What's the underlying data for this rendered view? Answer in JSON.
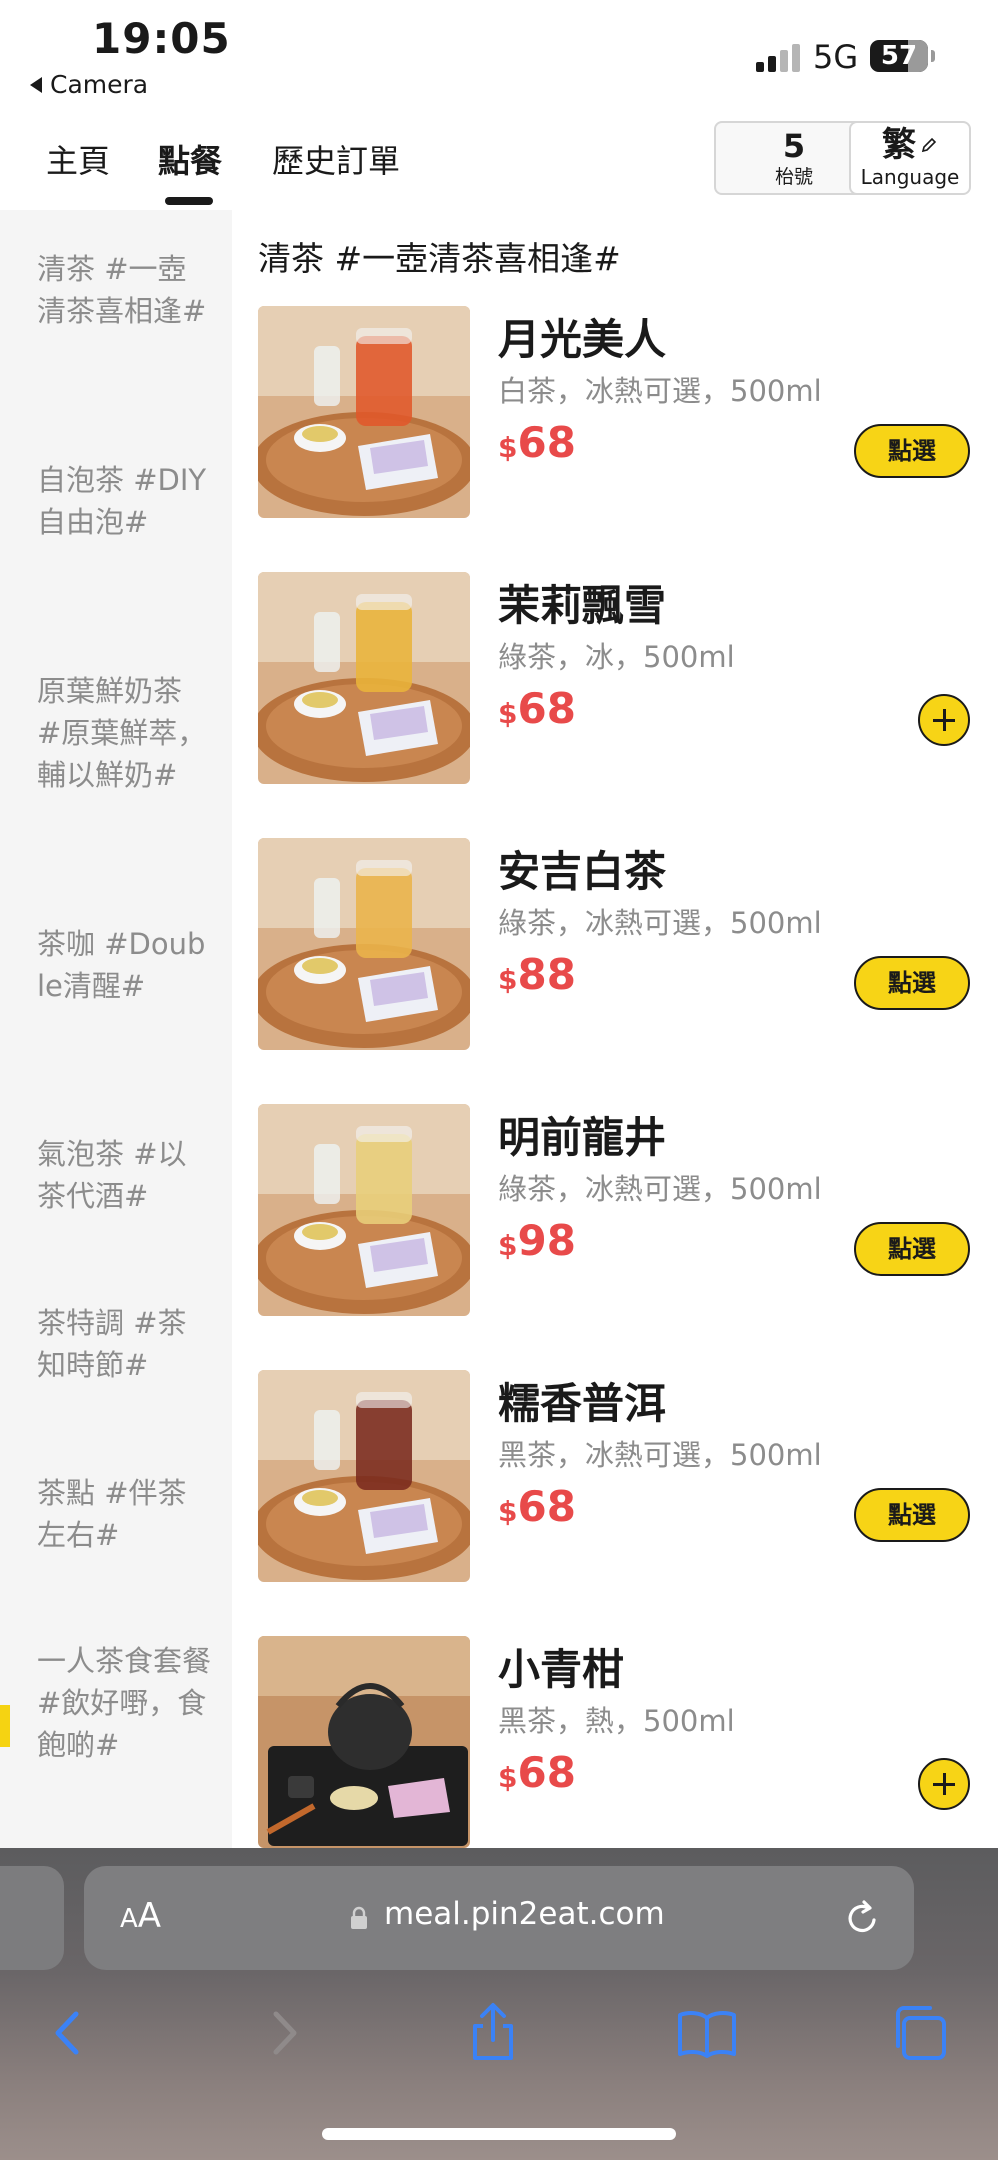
{
  "status_bar": {
    "time": "19:05",
    "back_app": "Camera",
    "network": "5G",
    "battery": "57"
  },
  "nav": {
    "tabs": [
      {
        "label": "主頁",
        "active": false
      },
      {
        "label": "點餐",
        "active": true
      },
      {
        "label": "歷史訂單",
        "active": false
      }
    ],
    "table_number": "5",
    "table_label": "枱號",
    "language_char": "繁",
    "language_label": "Language"
  },
  "sidebar": {
    "categories": [
      "清茶 #一壺清茶喜相逢#",
      "自泡茶 #DIY自由泡#",
      "原葉鮮奶茶 #原葉鮮萃，輔以鮮奶#",
      "茶咖 #Double清醒#",
      "氣泡茶 #以茶代酒#",
      "茶特調 #茶知時節#",
      "茶點 #伴茶左右#",
      "一人茶食套餐 #飲好嘢，食飽啲#"
    ]
  },
  "menu": {
    "section_title": "清茶 #一壺清茶喜相逢#",
    "currency": "$",
    "select_label": "點選",
    "items": [
      {
        "name": "月光美人",
        "desc": "白茶，冰熱可選，500ml",
        "price": "68",
        "button": "select",
        "tea_color": "#e0582a"
      },
      {
        "name": "茉莉飄雪",
        "desc": "綠茶，冰，500ml",
        "price": "68",
        "button": "add",
        "tea_color": "#e9b43a"
      },
      {
        "name": "安吉白茶",
        "desc": "綠茶，冰熱可選，500ml",
        "price": "88",
        "button": "select",
        "tea_color": "#eab44a"
      },
      {
        "name": "明前龍井",
        "desc": "綠茶，冰熱可選，500ml",
        "price": "98",
        "button": "select",
        "tea_color": "#e8cf7a"
      },
      {
        "name": "糯香普洱",
        "desc": "黑茶，冰熱可選，500ml",
        "price": "68",
        "button": "select",
        "tea_color": "#7a2a1e"
      },
      {
        "name": "小青柑",
        "desc": "黑茶，熱，500ml",
        "price": "68",
        "button": "add",
        "tea_color": "#333333"
      }
    ]
  },
  "browser": {
    "text_size_small": "A",
    "text_size_big": "A",
    "url": "meal.pin2eat.com"
  },
  "colors": {
    "accent_yellow": "#f7d416",
    "price_red": "#e84a4a",
    "toolbar_blue": "#3b82f6"
  }
}
